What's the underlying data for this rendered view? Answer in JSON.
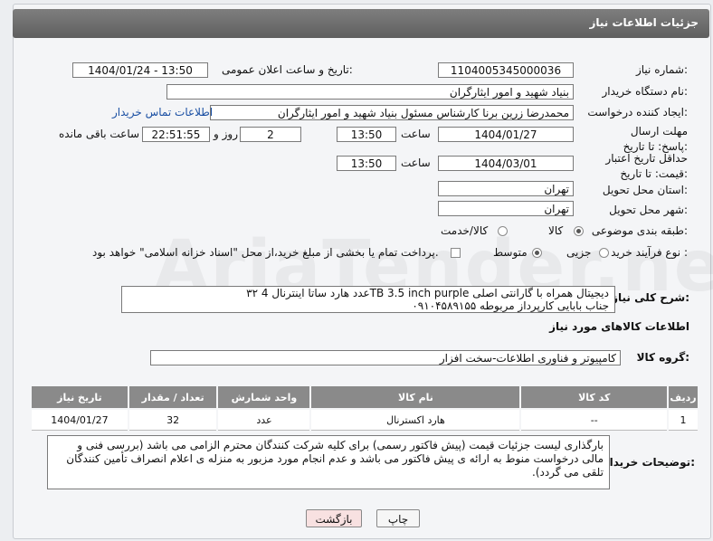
{
  "window_title": "جزئیات اطلاعات نیاز",
  "fields": {
    "need_number_label": "شماره نیاز:",
    "need_number": "1104005345000036",
    "announce_label": "تاریخ و ساعت اعلان عمومی:",
    "announce_value": "1404/01/24 - 13:50",
    "buyer_org_label": "نام دستگاه خریدار:",
    "buyer_org": "بنیاد شهید و امور ایثارگران",
    "creator_label": "ایجاد کننده درخواست:",
    "creator": "محمدرضا زرین برنا کارشناس مسئول  بنیاد شهید و امور ایثارگران",
    "contact_link": "اطلاعات تماس خریدار",
    "reply_deadline_label": "مهلت ارسال پاسخ: تا تاریخ:",
    "reply_date": "1404/01/27",
    "time_label": "ساعت",
    "reply_time": "13:50",
    "days_value": "2",
    "days_label": "روز و",
    "remaining_time": "22:51:55",
    "remaining_label": "ساعت باقی مانده",
    "price_validity_label": "حداقل تاریخ اعتبار قیمت: تا تاریخ:",
    "price_date": "1404/03/01",
    "price_time": "13:50",
    "province_label": "استان محل تحویل:",
    "province": "تهران",
    "city_label": "شهر محل تحویل:",
    "city": "تهران",
    "category_label": "طبقه بندی موضوعی:",
    "category_options": [
      "کالا",
      "کالا/خدمت"
    ],
    "purchase_type_label": "نوع فرآیند خرید :",
    "purchase_options": [
      "جزیی",
      "متوسط"
    ],
    "payment_note": "پرداخت تمام یا بخشی از مبلغ خرید،از محل \"اسناد خزانه اسلامی\" خواهد بود."
  },
  "description": {
    "label": "شرح کلی نیاز:",
    "line1": "۳۲ عدد هارد ساتا اینترنال 4TB 3.5 inch purple دیجیتال همراه با گارانتی اصلی",
    "line2": "۰۹۱۰۴۵۸۹۱۵۵ جناب بابایی کارپرداز مربوطه"
  },
  "goods_section_title": "اطلاعات کالاهای مورد نیاز",
  "goods_group": {
    "label": "گروه کالا:",
    "value": "کامپیوتر و فناوری اطلاعات-سخت افزار"
  },
  "table": {
    "headers": [
      "ردیف",
      "کد کالا",
      "نام کالا",
      "واحد شمارش",
      "تعداد / مقدار",
      "تاریخ نیاز"
    ],
    "rows": [
      [
        "1",
        "--",
        "هارد اکسترنال",
        "عدد",
        "32",
        "1404/01/27"
      ]
    ]
  },
  "buyer_notes": {
    "label": "توضیحات خریدار:",
    "text": "بارگذاری لیست جزئیات قیمت (پیش فاکتور رسمی) برای کلیه شرکت کنندگان محترم الزامی می باشد (بررسی فنی و مالی درخواست منوط به ارائه ی پیش فاکتور می باشد و عدم انجام مورد مزبور به منزله ی اعلام انصراف تأمین کنندگان تلقی می گردد)."
  },
  "buttons": {
    "print": "چاپ",
    "back": "بازگشت"
  },
  "watermark": "AriaTender.neT",
  "colors": {
    "title_bar": "#6b6b6b",
    "link": "#1a4fa3",
    "back_button": "#f8e1e1"
  }
}
